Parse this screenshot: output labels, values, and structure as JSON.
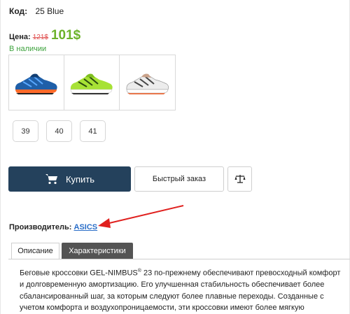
{
  "product": {
    "code_label": "Код:",
    "code_value": "25 Blue",
    "price_label": "Цена:",
    "old_price": "121$",
    "new_price": "101$",
    "stock": "В наличии",
    "thumbnails": [
      {
        "icon": "blue-running-shoe",
        "colors": {
          "upper": "#1f5fa8",
          "sole": "#ff6a2a"
        }
      },
      {
        "icon": "lime-running-shoe",
        "colors": {
          "upper": "#a7e235",
          "sole": "#ffffff"
        }
      },
      {
        "icon": "white-running-shoe",
        "colors": {
          "upper": "#ececec",
          "sole": "#ffffff"
        }
      }
    ],
    "sizes": [
      "39",
      "40",
      "41"
    ]
  },
  "actions": {
    "buy_label": "Купить",
    "quick_order_label": "Быстрый заказ",
    "compare_icon": "scales-icon"
  },
  "manufacturer": {
    "label": "Производитель:",
    "value": "ASICS"
  },
  "tabs": [
    {
      "label": "Описание",
      "active": true
    },
    {
      "label": "Характеристики",
      "active": false
    }
  ],
  "description": {
    "part1": "Беговые кроссовки GEL-NIMBUS",
    "reg": "®",
    "part2": " 23 по-прежнему обеспечивают превосходный комфорт и долговременную амортизацию. Его улучшенная стабильность обеспечивает более сбалансированный шаг, за которым следуют более плавные переходы. Созданные с учетом комфорта и воздухопроницаемости, эти кроссовки имеют более мягкую"
  },
  "colors": {
    "accent_navy": "#24415c",
    "price_green": "#6cb22a",
    "old_price_red": "#e05050",
    "stock_green": "#3ea33e",
    "link_blue": "#2a6ec8",
    "annotation_arrow": "#e0201e"
  }
}
